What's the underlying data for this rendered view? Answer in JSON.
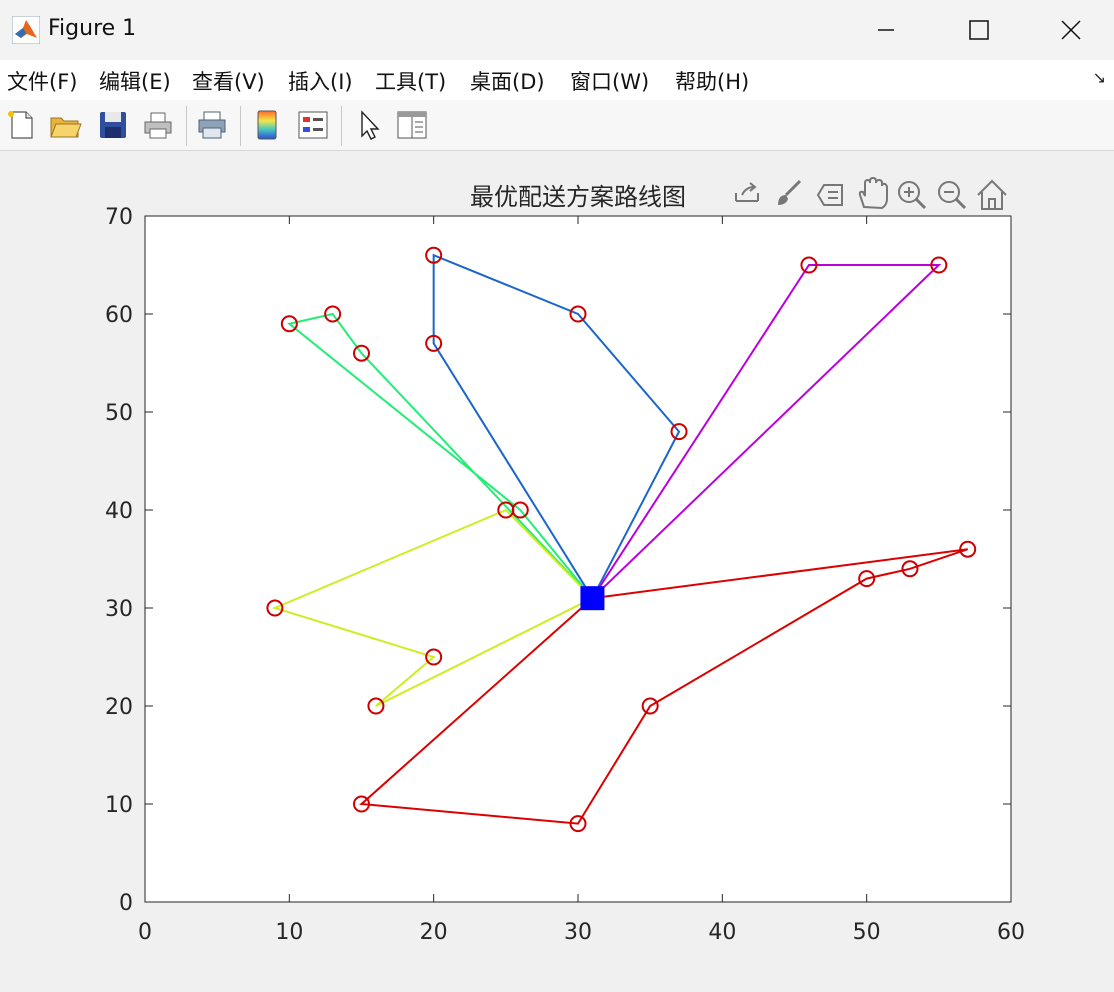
{
  "window": {
    "title": "Figure 1"
  },
  "menu": [
    "文件(F)",
    "编辑(E)",
    "查看(V)",
    "插入(I)",
    "工具(T)",
    "桌面(D)",
    "窗口(W)",
    "帮助(H)"
  ],
  "toolbar": {
    "buttons": [
      "new-figure",
      "open-file",
      "save",
      "print",
      "print-preview",
      "insert-colorbar",
      "insert-legend",
      "edit-plot",
      "property-inspector"
    ]
  },
  "axes_toolbar": [
    "export",
    "brush",
    "data-tips",
    "pan",
    "zoom-in",
    "zoom-out",
    "restore-view"
  ],
  "chart_data": {
    "type": "line",
    "title": "最优配送方案路线图",
    "xlabel": "",
    "ylabel": "",
    "xlim": [
      0,
      60
    ],
    "ylim": [
      0,
      70
    ],
    "xticks": [
      0,
      10,
      20,
      30,
      40,
      50,
      60
    ],
    "yticks": [
      0,
      10,
      20,
      30,
      40,
      50,
      60,
      70
    ],
    "grid": false,
    "depot": {
      "x": 31,
      "y": 31,
      "marker": "square",
      "color": "#0000ff"
    },
    "customer_marker": {
      "shape": "circle",
      "color": "#cc0000"
    },
    "series": [
      {
        "color": "#dd0000",
        "points": [
          [
            31,
            31
          ],
          [
            57,
            36
          ],
          [
            53,
            34
          ],
          [
            50,
            33
          ],
          [
            35,
            20
          ],
          [
            30,
            8
          ],
          [
            15,
            10
          ],
          [
            31,
            31
          ]
        ]
      },
      {
        "color": "#1a66cc",
        "points": [
          [
            31,
            31
          ],
          [
            37,
            48
          ],
          [
            30,
            60
          ],
          [
            20,
            66
          ],
          [
            20,
            57
          ],
          [
            31,
            31
          ]
        ]
      },
      {
        "color": "#bb00dd",
        "points": [
          [
            31,
            31
          ],
          [
            55,
            65
          ],
          [
            46,
            65
          ],
          [
            31,
            31
          ]
        ]
      },
      {
        "color": "#22ee77",
        "points": [
          [
            31,
            31
          ],
          [
            15,
            56
          ],
          [
            13,
            60
          ],
          [
            10,
            59
          ],
          [
            26,
            40
          ],
          [
            31,
            31
          ]
        ]
      },
      {
        "color": "#ccee22",
        "points": [
          [
            31,
            31
          ],
          [
            16,
            20
          ],
          [
            20,
            25
          ],
          [
            9,
            30
          ],
          [
            25,
            40
          ],
          [
            31,
            31
          ]
        ]
      }
    ]
  },
  "colors": {
    "axes_bg": "#ffffff",
    "figure_bg": "#f0f0f0",
    "axis_line": "#262626"
  }
}
